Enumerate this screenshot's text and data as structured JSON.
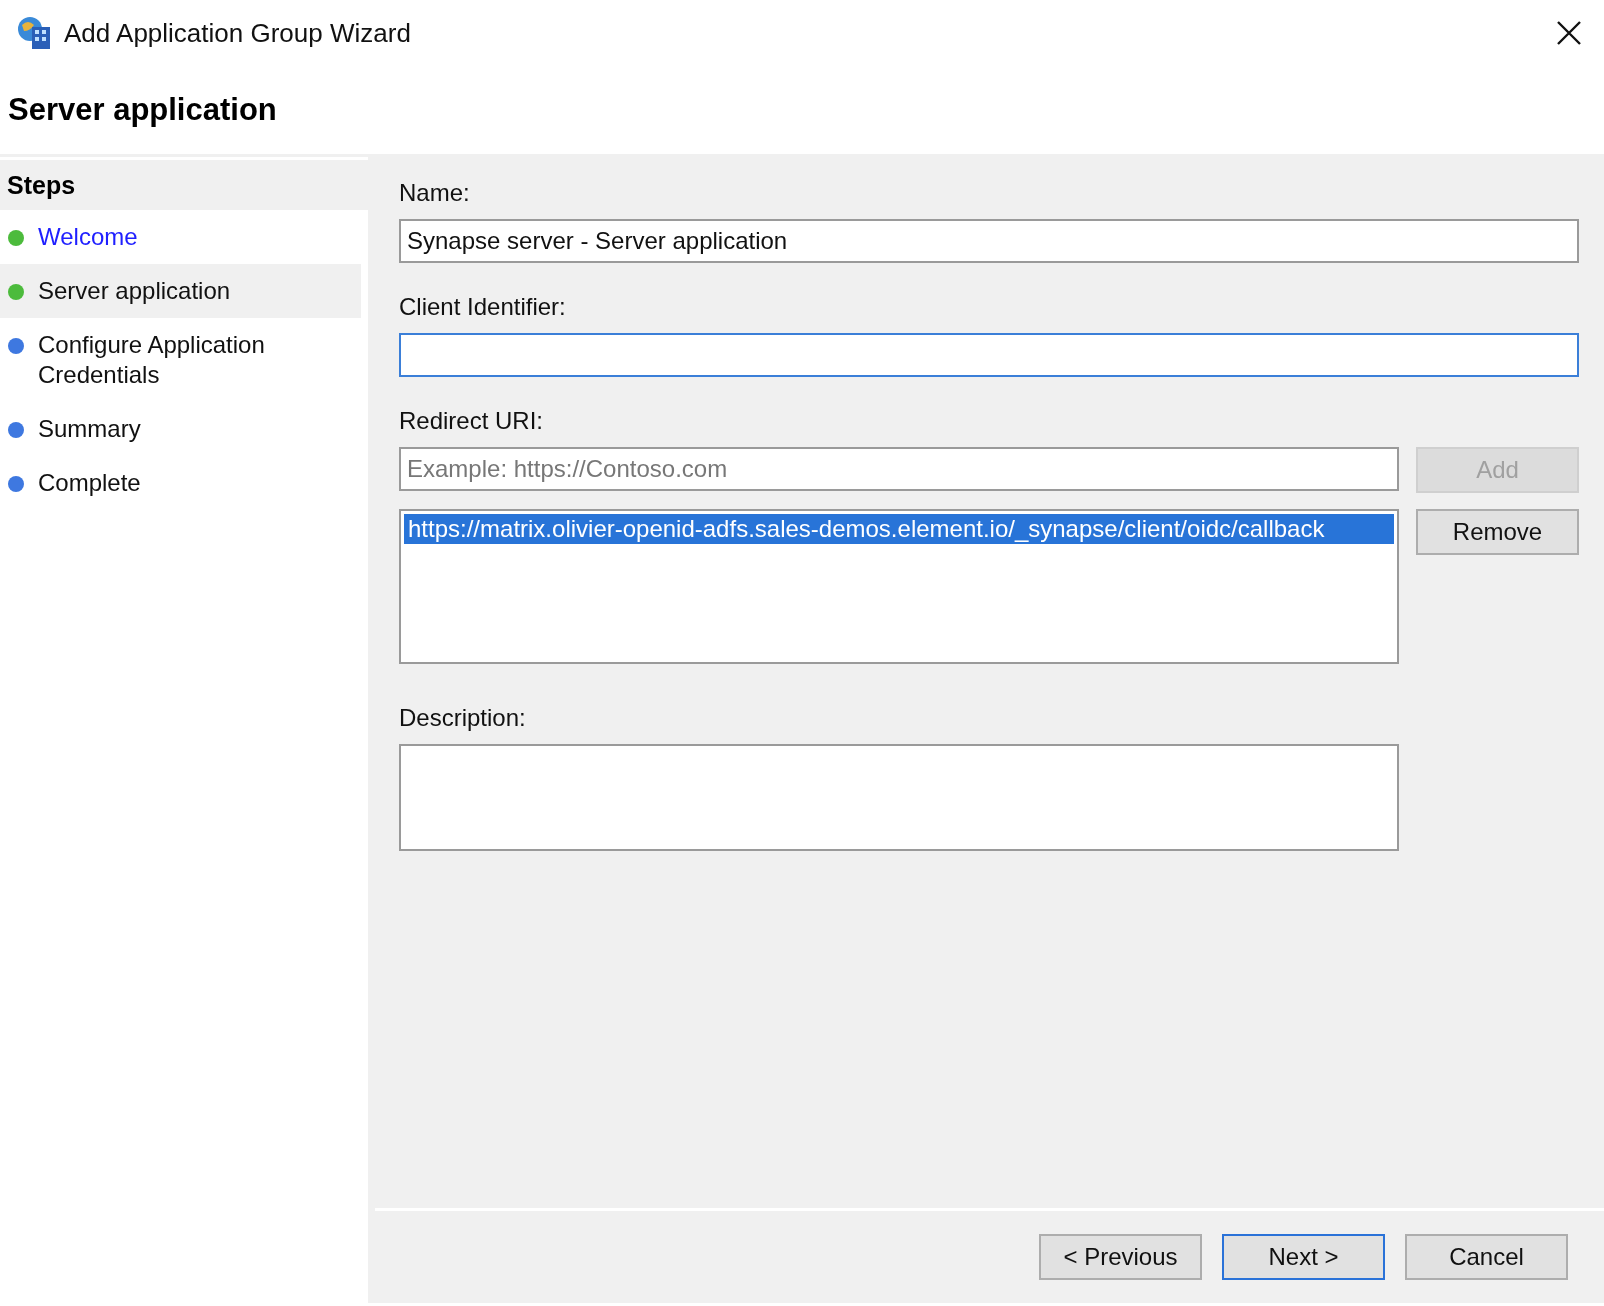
{
  "window": {
    "title": "Add Application Group Wizard"
  },
  "page_title": "Server application",
  "steps": {
    "heading": "Steps",
    "items": [
      {
        "label": "Welcome",
        "color": "#4cbb3c",
        "kind": "link",
        "selected": false
      },
      {
        "label": "Server application",
        "color": "#4cbb3c",
        "kind": "text",
        "selected": true
      },
      {
        "label": "Configure Application Credentials",
        "color": "#3e78e0",
        "kind": "text",
        "selected": false
      },
      {
        "label": "Summary",
        "color": "#3e78e0",
        "kind": "text",
        "selected": false
      },
      {
        "label": "Complete",
        "color": "#3e78e0",
        "kind": "text",
        "selected": false
      }
    ]
  },
  "form": {
    "name": {
      "label": "Name:",
      "value": "Synapse server - Server application"
    },
    "client_identifier": {
      "label": "Client Identifier:",
      "focused": true
    },
    "redirect_uri": {
      "label": "Redirect URI:",
      "placeholder": "Example: https://Contoso.com",
      "add_button": {
        "label": "Add",
        "disabled": true
      },
      "list": [
        {
          "text": "https://matrix.olivier-openid-adfs.sales-demos.element.io/_synapse/client/oidc/callback",
          "selected": true
        }
      ],
      "remove_button": {
        "label": "Remove",
        "disabled": false
      }
    },
    "description": {
      "label": "Description:"
    }
  },
  "buttons": [
    {
      "label": "< Previous",
      "default": false
    },
    {
      "label": "Next >",
      "default": true
    },
    {
      "label": "Cancel",
      "default": false
    }
  ]
}
